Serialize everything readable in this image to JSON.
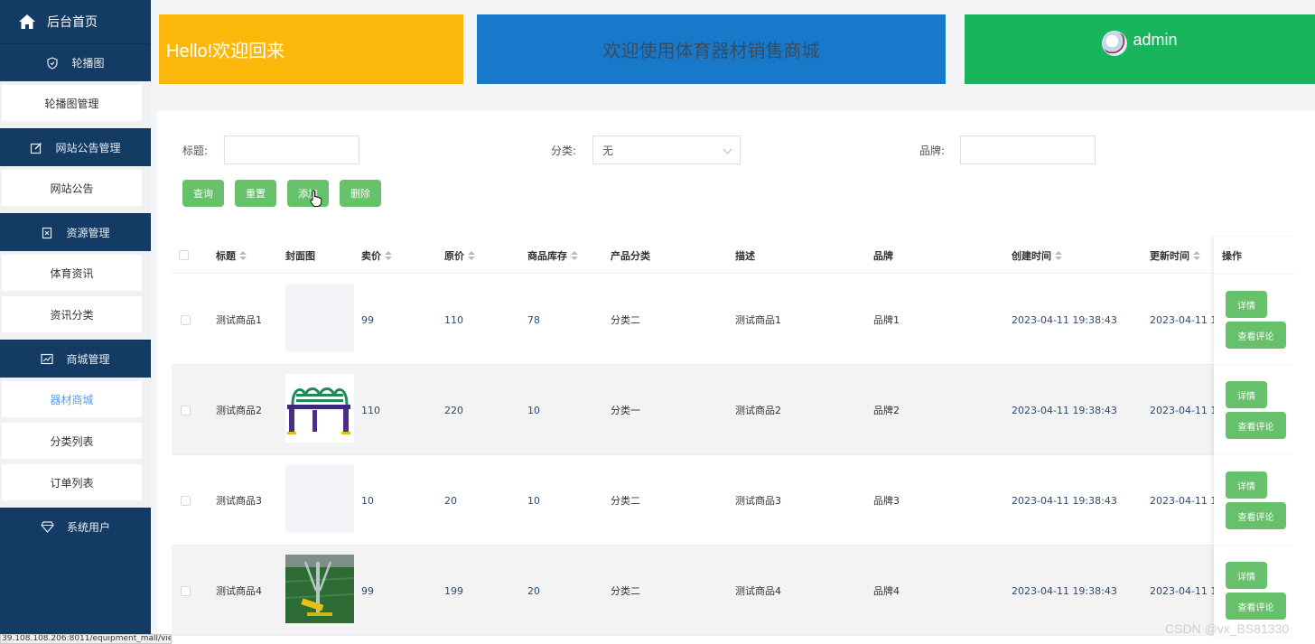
{
  "sidebar": {
    "home_label": "后台首页",
    "groups": [
      {
        "label": "轮播图",
        "icon": "shield-icon",
        "items": [
          "轮播图管理"
        ]
      },
      {
        "label": "网站公告管理",
        "icon": "edit-icon",
        "items": [
          "网站公告"
        ]
      },
      {
        "label": "资源管理",
        "icon": "resource-icon",
        "items": [
          "体育资讯",
          "资讯分类"
        ]
      },
      {
        "label": "商城管理",
        "icon": "chart-icon",
        "items": [
          "器材商城",
          "分类列表",
          "订单列表"
        ]
      },
      {
        "label": "系统用户",
        "icon": "diamond-icon",
        "items": []
      }
    ],
    "active_item": "器材商城"
  },
  "header": {
    "greeting": "Hello!欢迎回来",
    "welcome": "欢迎使用体育器材销售商城",
    "username": "admin"
  },
  "filters": {
    "title_label": "标题:",
    "title_value": "",
    "category_label": "分类:",
    "category_value": "无",
    "brand_label": "品牌:",
    "brand_value": ""
  },
  "actions": {
    "query": "查询",
    "reset": "重置",
    "add": "添加",
    "delete": "删除"
  },
  "table": {
    "columns": {
      "title": "标题",
      "cover": "封面图",
      "price": "卖价",
      "original_price": "原价",
      "stock": "商品库存",
      "category": "产品分类",
      "description": "描述",
      "brand": "品牌",
      "created": "创建时间",
      "updated": "更新时间",
      "ops": "操作"
    },
    "rows": [
      {
        "title": "测试商品1",
        "price": "99",
        "original_price": "110",
        "stock": "78",
        "category": "分类二",
        "description": "测试商品1",
        "brand": "品牌1",
        "created": "2023-04-11 19:38:43",
        "updated": "2023-04-11 1"
      },
      {
        "title": "测试商品2",
        "price": "110",
        "original_price": "220",
        "stock": "10",
        "category": "分类一",
        "description": "测试商品2",
        "brand": "品牌2",
        "created": "2023-04-11 19:38:43",
        "updated": "2023-04-11 1"
      },
      {
        "title": "测试商品3",
        "price": "10",
        "original_price": "20",
        "stock": "10",
        "category": "分类二",
        "description": "测试商品3",
        "brand": "品牌3",
        "created": "2023-04-11 19:38:43",
        "updated": "2023-04-11 1"
      },
      {
        "title": "测试商品4",
        "price": "99",
        "original_price": "199",
        "stock": "20",
        "category": "分类二",
        "description": "测试商品4",
        "brand": "品牌4",
        "created": "2023-04-11 19:38:43",
        "updated": "2023-04-11 1"
      }
    ],
    "row_buttons": {
      "detail": "详情",
      "comments": "查看评论"
    }
  },
  "status_url": "39.108.108.206:8011/equipment_mall/view",
  "watermark": "CSDN @vx_BS81330",
  "colors": {
    "sidebar": "#143b63",
    "yellow": "#fbb80b",
    "blue": "#1879cb",
    "green": "#19b55c",
    "button": "#67c06a"
  }
}
